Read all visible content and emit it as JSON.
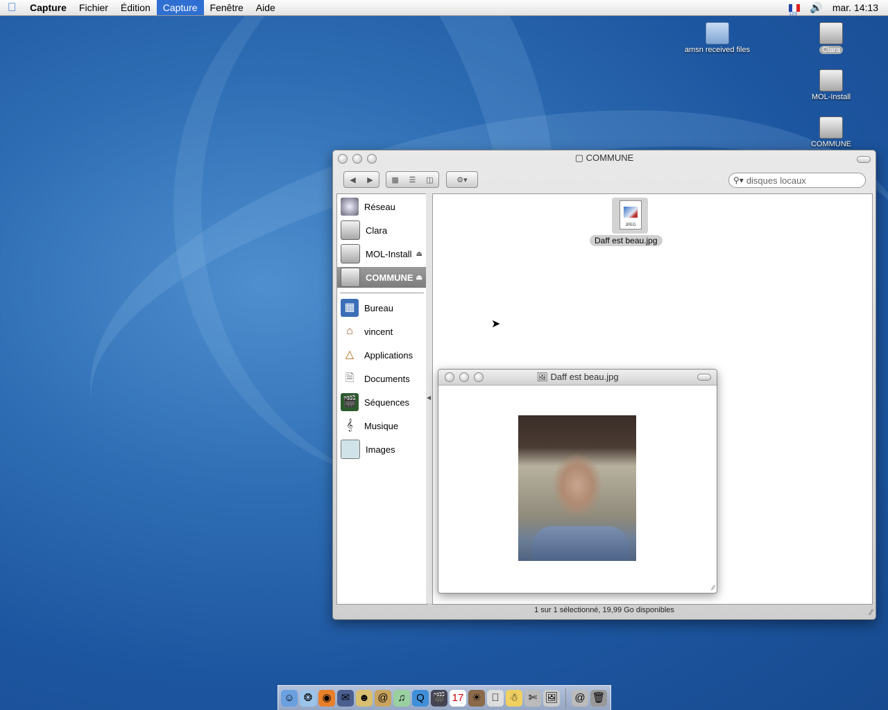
{
  "menubar": {
    "app": "Capture",
    "items": [
      "Fichier",
      "Édition",
      "Capture",
      "Fenêtre",
      "Aide"
    ],
    "active_index": 2,
    "flag_sub": "123",
    "clock": "mar. 14:13"
  },
  "desktop": {
    "icons": [
      {
        "label": "amsn received files",
        "kind": "folder"
      },
      {
        "label": "Clara",
        "kind": "disk",
        "selected": true
      },
      {
        "label": "MOL-Install",
        "kind": "disk"
      },
      {
        "label": "COMMUNE",
        "kind": "disk"
      }
    ]
  },
  "finder": {
    "title": "COMMUNE",
    "search_value": "disques locaux",
    "sidebar": {
      "devices": [
        {
          "label": "Réseau",
          "icon": "network-icon"
        },
        {
          "label": "Clara",
          "icon": "disk-icon"
        },
        {
          "label": "MOL-Install",
          "icon": "disk-icon",
          "eject": true
        },
        {
          "label": "COMMUNE",
          "icon": "disk-icon",
          "eject": true,
          "selected": true
        }
      ],
      "places": [
        {
          "label": "Bureau",
          "icon": "desktop-icon"
        },
        {
          "label": "vincent",
          "icon": "home-icon"
        },
        {
          "label": "Applications",
          "icon": "applications-icon"
        },
        {
          "label": "Documents",
          "icon": "documents-icon"
        },
        {
          "label": "Séquences",
          "icon": "movies-icon"
        },
        {
          "label": "Musique",
          "icon": "music-icon"
        },
        {
          "label": "Images",
          "icon": "pictures-icon"
        }
      ]
    },
    "file": {
      "name": "Daff est beau.jpg",
      "type_tag": "JPEG"
    },
    "status": "1 sur 1 sélectionné, 19,99 Go disponibles"
  },
  "preview": {
    "title": "Daff est beau.jpg"
  },
  "colors": {
    "accent": "#2f6fd1",
    "selection_gray": "#8a8a8a"
  }
}
